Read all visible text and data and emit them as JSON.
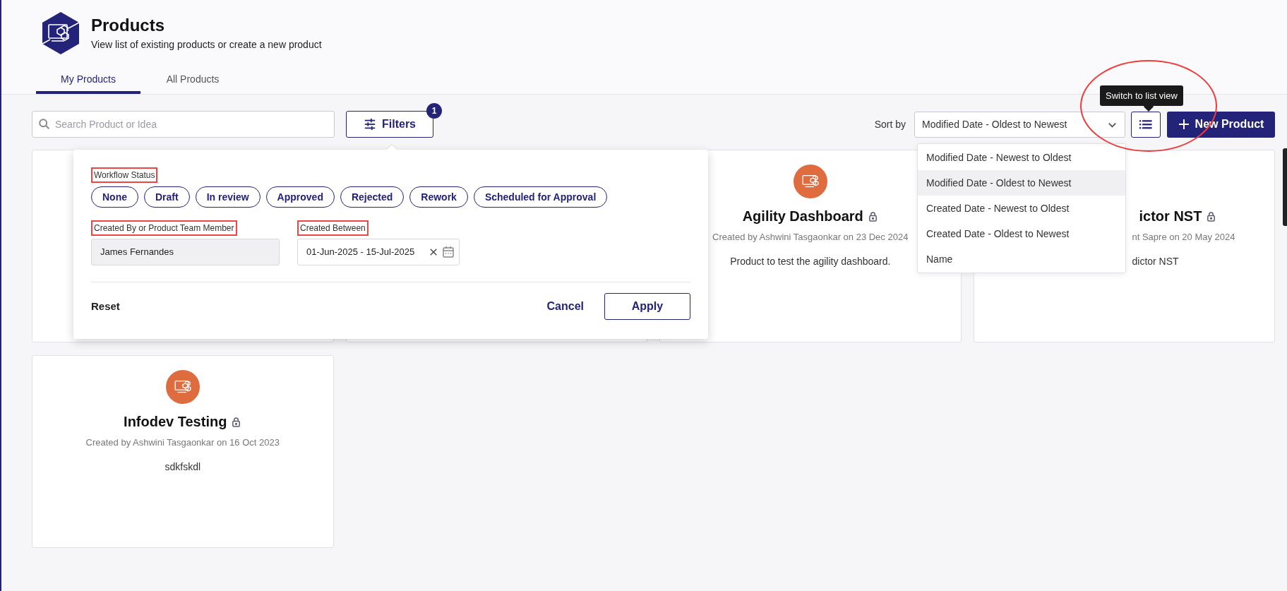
{
  "header": {
    "title": "Products",
    "subtitle": "View list of existing products or create a new product"
  },
  "tabs": [
    {
      "label": "My Products",
      "selected": true
    },
    {
      "label": "All Products",
      "selected": false
    }
  ],
  "search": {
    "placeholder": "Search Product or Idea"
  },
  "filters_button": {
    "label": "Filters",
    "badge": "1"
  },
  "sort": {
    "label": "Sort by",
    "value": "Modified Date - Oldest to Newest",
    "options": [
      {
        "label": "Modified Date - Newest to Oldest",
        "selected": false
      },
      {
        "label": "Modified Date - Oldest to Newest",
        "selected": true
      },
      {
        "label": "Created Date - Newest to Oldest",
        "selected": false
      },
      {
        "label": "Created Date - Oldest to Newest",
        "selected": false
      },
      {
        "label": "Name",
        "selected": false
      }
    ]
  },
  "view_toggle": {
    "tooltip": "Switch to list view"
  },
  "new_button": {
    "label": "New Product"
  },
  "products": [
    {
      "kind": "covered"
    },
    {
      "kind": "covered"
    },
    {
      "kind": "full",
      "title": "Agility Dashboard",
      "locked": true,
      "byline": "Created by Ashwini Tasgaonkar on 23 Dec 2024",
      "description": "Product to test the agility dashboard."
    },
    {
      "kind": "partial",
      "title": "ictor NST",
      "locked": true,
      "byline": "nt Sapre on 20 May 2024",
      "description": "dictor NST"
    },
    {
      "kind": "full",
      "title": "Infodev Testing",
      "locked": true,
      "byline": "Created by Ashwini Tasgaonkar on 16 Oct 2023",
      "description": "sdkfskdl"
    }
  ],
  "filter_panel": {
    "workflow_status": {
      "label": "Workflow Status",
      "annotated": true,
      "chips": [
        {
          "label": "None",
          "selected": false
        },
        {
          "label": "Draft",
          "selected": false
        },
        {
          "label": "In review",
          "selected": false
        },
        {
          "label": "Approved",
          "selected": false
        },
        {
          "label": "Rejected",
          "selected": false
        },
        {
          "label": "Rework",
          "selected": false
        },
        {
          "label": "Scheduled for Approval",
          "selected": false
        }
      ]
    },
    "created_by": {
      "label": "Created By or Product Team Member",
      "annotated": true,
      "value": "James Fernandes"
    },
    "created_between": {
      "label": "Created Between",
      "annotated": true,
      "value": "01-Jun-2025 - 15-Jul-2025"
    },
    "reset": "Reset",
    "cancel": "Cancel",
    "apply": "Apply"
  }
}
